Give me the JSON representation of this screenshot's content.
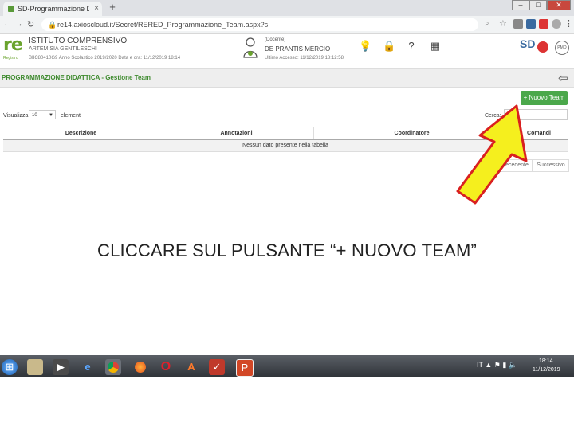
{
  "browser": {
    "tab_title": "SD-Programmazione Didattica - ",
    "tab_close": "×",
    "new_tab": "+",
    "url": "re14.axioscloud.it/Secret/RERED_Programmazione_Team.aspx?s",
    "window_controls": {
      "minimize": "–",
      "maximize": "□",
      "close": "✕"
    }
  },
  "header": {
    "logo": "re",
    "logo_sub": "Registro",
    "school_name": "ISTITUTO COMPRENSIVO",
    "school_sub": "ARTEMISIA GENTILESCHI",
    "meta": "BIIC80410G9     Anno Scolastico 2019/2020     Data e ora: 11/12/2019 18:14",
    "user_role": "(Docente)",
    "user_name": "DE PRANTIS MERCIO",
    "last_access": "Ultimo Accesso: 11/12/2019 18:12:58",
    "sd_logo": "SD",
    "pmo": "PMO"
  },
  "page": {
    "title": "PROGRAMMAZIONE DIDATTICA - Gestione Team"
  },
  "toolbar": {
    "new_team_label": "+ Nuovo Team",
    "show_label": "Visualizza",
    "page_size": "10",
    "elements_label": "elementi",
    "search_label": "Cerca:"
  },
  "table": {
    "columns": [
      "Descrizione",
      "Annotazioni",
      "Coordinatore",
      "Comandi"
    ],
    "empty_message": "Nessun dato presente nella tabella"
  },
  "pagination": {
    "prev": "Precedente",
    "next": "Successivo"
  },
  "annotation": {
    "caption": "CLICCARE SUL PULSANTE “+ NUOVO TEAM”",
    "arrow_color": "#f5ef1e",
    "arrow_border": "#d92020"
  },
  "taskbar": {
    "clock_time": "18:14",
    "clock_date": "11/12/2019",
    "tray_lang": "IT"
  },
  "colors": {
    "brand_green": "#6aa32d",
    "title_green": "#3f8b2f",
    "button_green": "#4ba84b"
  }
}
